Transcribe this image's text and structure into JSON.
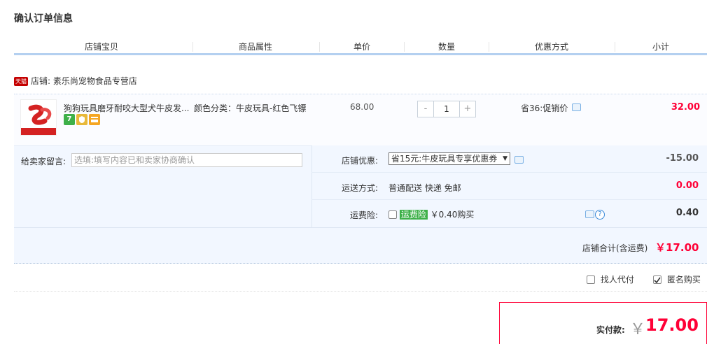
{
  "page": {
    "title": "确认订单信息"
  },
  "table": {
    "headers": [
      "店铺宝贝",
      "商品属性",
      "单价",
      "数量",
      "优惠方式",
      "小计"
    ]
  },
  "shop": {
    "badge": "天猫",
    "label": "店铺: 素乐尚宠物食品专营店"
  },
  "item": {
    "name": "狗狗玩具磨牙耐咬大型犬牛皮发...",
    "attribute": "颜色分类：牛皮玩具-红色飞镖",
    "price": "68.00",
    "qty_minus": "-",
    "qty": "1",
    "qty_plus": "+",
    "discount": "省36:促销价",
    "subtotal": "32.00",
    "service_icons": [
      {
        "name": "seven-day-return-icon",
        "text": "7",
        "color": "#3eb049"
      },
      {
        "name": "shield-guarantee-icon",
        "text": "",
        "color": "#e8b93a"
      },
      {
        "name": "credit-card-icon",
        "text": "",
        "color": "#f5a623"
      }
    ]
  },
  "message": {
    "label": "给卖家留言:",
    "placeholder": "选填:填写内容已和卖家协商确认"
  },
  "shop_discount": {
    "label": "店铺优惠:",
    "selected": "省15元:牛皮玩具专享优惠券",
    "value": "-15.00"
  },
  "shipping": {
    "label": "运送方式:",
    "text": "普通配送 快递 免邮",
    "value": "0.00"
  },
  "insurance": {
    "label": "运费险:",
    "tag": "运费险",
    "text": "￥0.40购买",
    "value": "0.40"
  },
  "shop_total": {
    "label": "店铺合计(含运费)",
    "value": "￥17.00"
  },
  "options": {
    "pay_for_me": "找人代付",
    "anonymous": "匿名购买"
  },
  "payment": {
    "label": "实付款:",
    "currency": "￥",
    "amount": "17.00"
  },
  "colors": {
    "accent": "#ff0036",
    "header_bar": "#b4d0f0",
    "panel_bg": "#f2f7ff"
  }
}
